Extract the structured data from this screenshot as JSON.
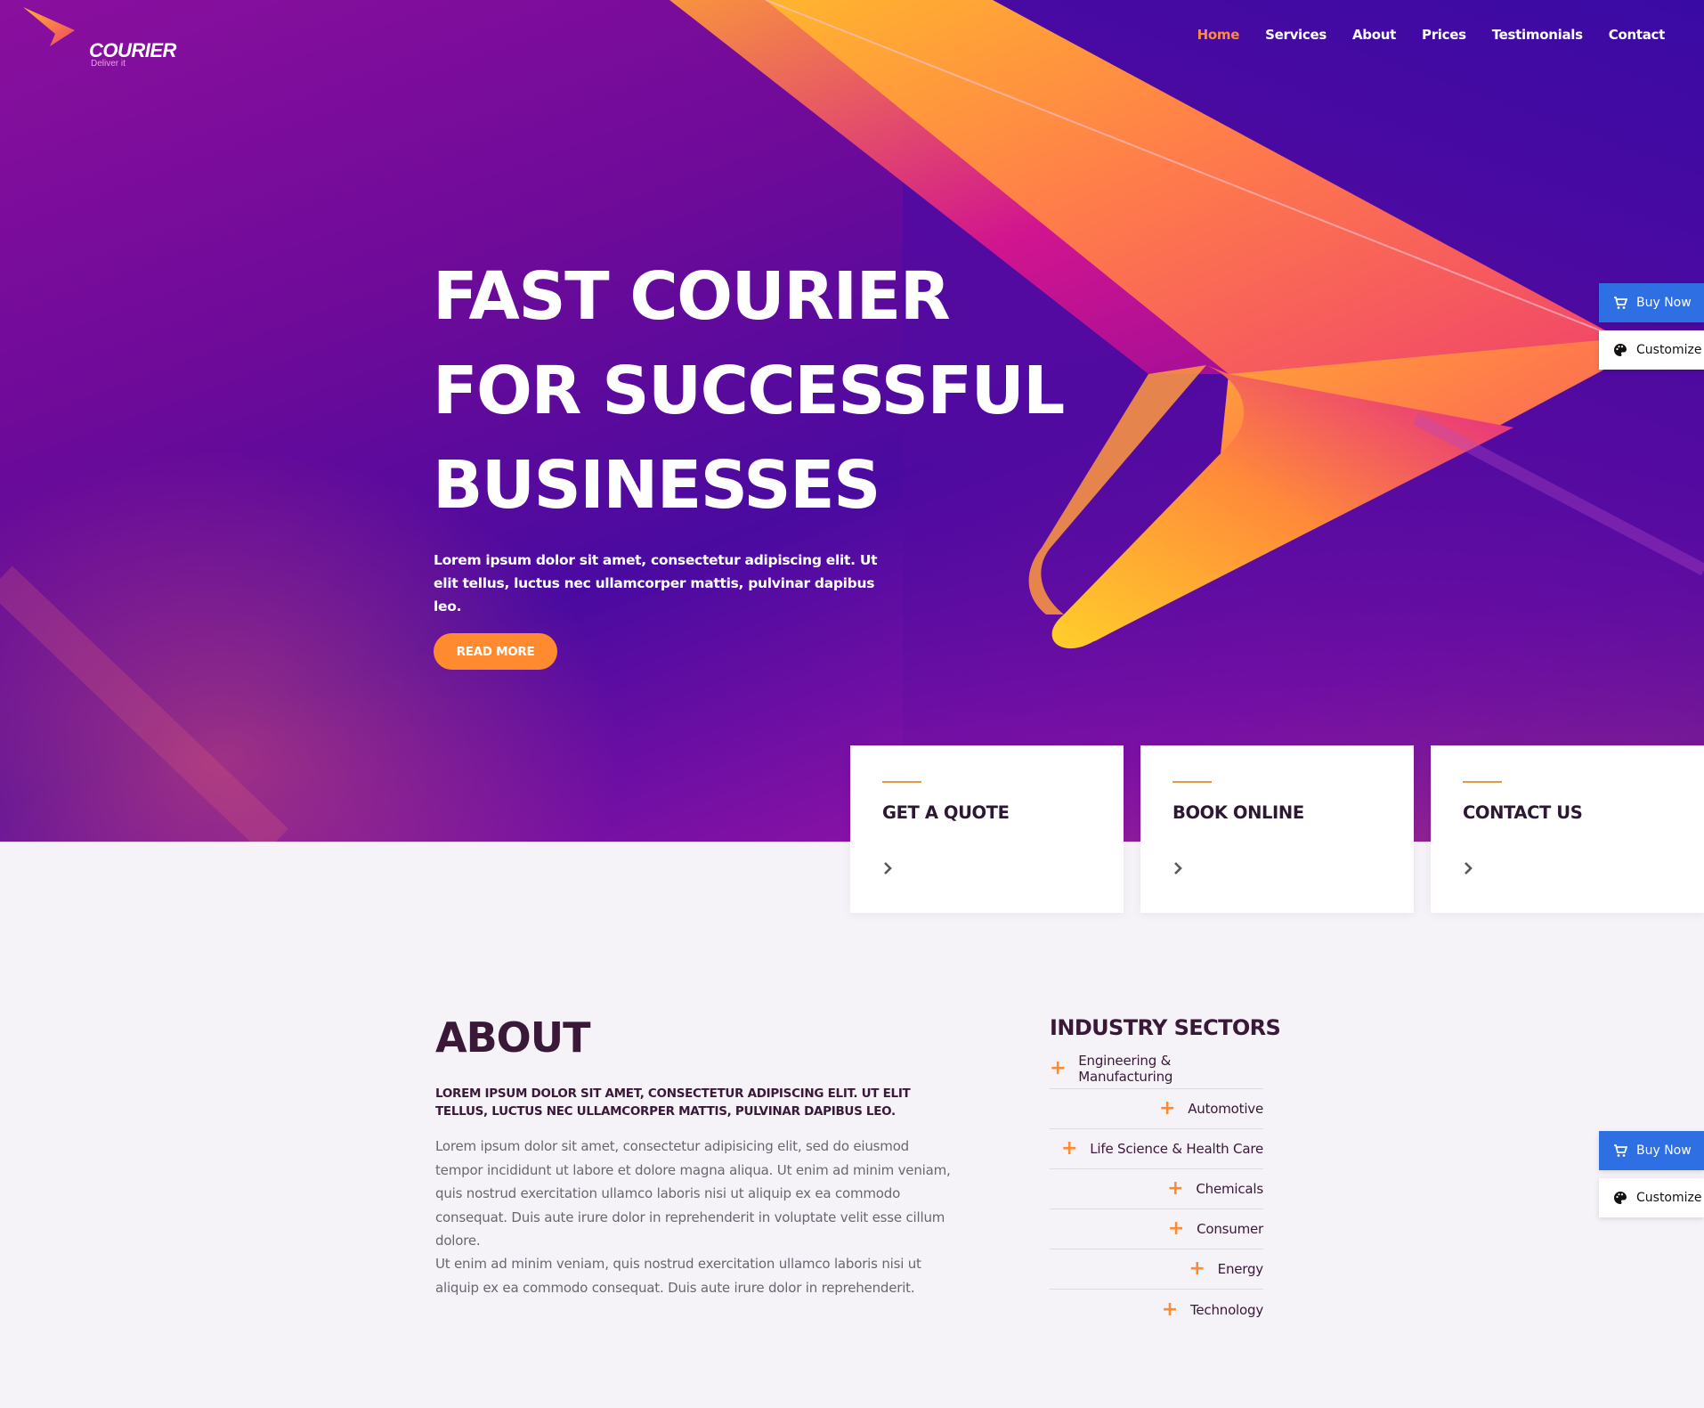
{
  "brand": {
    "name": "COURIER",
    "tagline": "Deliver it"
  },
  "nav": {
    "items": [
      "Home",
      "Services",
      "About",
      "Prices",
      "Testimonials",
      "Contact"
    ],
    "active": "Home"
  },
  "hero": {
    "title_lines": [
      "FAST COURIER",
      "FOR SUCCESSFUL",
      "BUSINESSES"
    ],
    "subtitle": "Lorem ipsum dolor sit amet, consectetur adipiscing elit. Ut elit tellus, luctus nec ullamcorper mattis, pulvinar dapibus leo.",
    "cta": "READ MORE"
  },
  "side_buttons": {
    "buy": "Buy Now",
    "customize": "Customize"
  },
  "cards": [
    {
      "title": "GET A QUOTE"
    },
    {
      "title": "BOOK ONLINE"
    },
    {
      "title": "CONTACT US"
    }
  ],
  "about": {
    "title": "ABOUT",
    "lead": "LOREM IPSUM DOLOR SIT AMET, CONSECTETUR ADIPISCING ELIT. UT ELIT TELLUS, LUCTUS NEC ULLAMCORPER MATTIS, PULVINAR DAPIBUS LEO.",
    "p1": "Lorem ipsum dolor sit amet, consectetur adipisicing elit, sed do eiusmod tempor incididunt ut labore et dolore magna aliqua. Ut enim ad minim veniam, quis nostrud exercitation ullamco laboris nisi ut aliquip ex ea commodo consequat. Duis aute irure dolor in reprehenderit in voluptate velit esse cillum dolore.",
    "p2": "Ut enim ad minim veniam, quis nostrud exercitation ullamco laboris nisi ut aliquip ex ea commodo consequat. Duis aute irure dolor in reprehenderit."
  },
  "sectors": {
    "title": "INDUSTRY SECTORS",
    "items": [
      "Engineering & Manufacturing",
      "Automotive",
      "Life Science & Health Care",
      "Chemicals",
      "Consumer",
      "Energy",
      "Technology"
    ]
  },
  "colors": {
    "accent_orange": "#ff8a30",
    "nav_active": "#ff8a3d",
    "buy_blue": "#2f6fe4",
    "heading_dark": "#3a1838",
    "hero_purple": "#6e0a99"
  },
  "icons": {
    "cart": "cart-icon",
    "palette": "palette-icon",
    "chevron": "chevron-right-icon",
    "plus": "plus-icon"
  }
}
